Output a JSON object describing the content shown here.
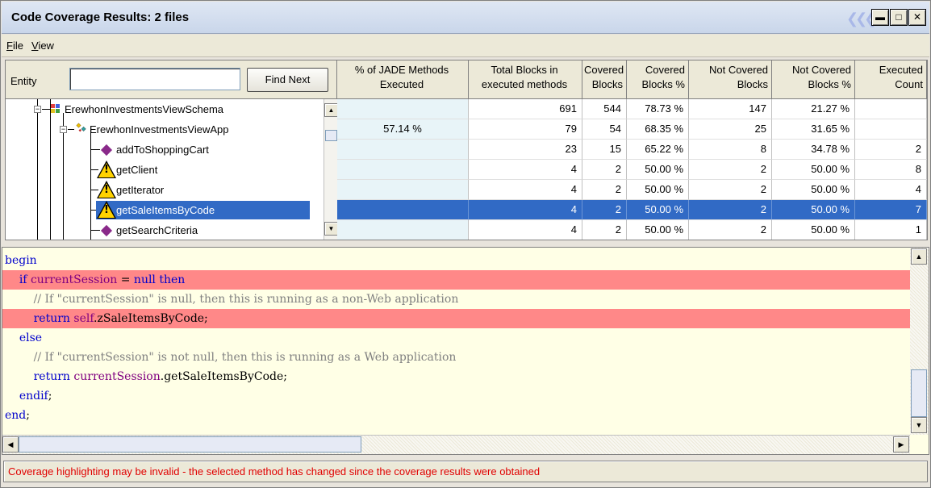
{
  "window": {
    "title": "Code Coverage Results: 2 files",
    "buttons": {
      "minimize": "▬",
      "maximize": "□",
      "close": "✕"
    }
  },
  "menu": [
    {
      "label": "File",
      "mnemonic": "F",
      "rest": "ile"
    },
    {
      "label": "View",
      "mnemonic": "V",
      "rest": "iew"
    }
  ],
  "entity_filter": {
    "label": "Entity",
    "value": "",
    "find_button": "Find Next"
  },
  "tree": [
    {
      "label": "ErewhonInvestmentsViewSchema",
      "icon": "schema-icon",
      "level": 0
    },
    {
      "label": "ErewhonInvestmentsViewApp",
      "icon": "application-icon",
      "level": 1
    },
    {
      "label": "addToShoppingCart",
      "icon": "method-icon",
      "level": 2
    },
    {
      "label": "getClient",
      "icon": "warning-icon",
      "level": 2
    },
    {
      "label": "getIterator",
      "icon": "warning-icon",
      "level": 2
    },
    {
      "label": "getSaleItemsByCode",
      "icon": "warning-icon",
      "level": 2,
      "selected": true
    },
    {
      "label": "getSearchCriteria",
      "icon": "method-icon",
      "level": 2
    }
  ],
  "grid": {
    "columns": [
      {
        "line1": "% of JADE Methods",
        "line2": "Executed"
      },
      {
        "line1": "Total Blocks in",
        "line2": "executed methods"
      },
      {
        "line1": "Covered",
        "line2": "Blocks"
      },
      {
        "line1": "Covered",
        "line2": "Blocks %"
      },
      {
        "line1": "Not Covered",
        "line2": "Blocks"
      },
      {
        "line1": "Not Covered",
        "line2": "Blocks %"
      },
      {
        "line1": "Executed",
        "line2": "Count"
      }
    ],
    "rows": [
      [
        "",
        "691",
        "544",
        "78.73 %",
        "147",
        "21.27 %",
        ""
      ],
      [
        "57.14 %",
        "79",
        "54",
        "68.35 %",
        "25",
        "31.65 %",
        ""
      ],
      [
        "",
        "23",
        "15",
        "65.22 %",
        "8",
        "34.78 %",
        "2"
      ],
      [
        "",
        "4",
        "2",
        "50.00 %",
        "2",
        "50.00 %",
        "8"
      ],
      [
        "",
        "4",
        "2",
        "50.00 %",
        "2",
        "50.00 %",
        "4"
      ],
      [
        "",
        "4",
        "2",
        "50.00 %",
        "2",
        "50.00 %",
        "7"
      ],
      [
        "",
        "4",
        "2",
        "50.00 %",
        "2",
        "50.00 %",
        "1"
      ]
    ],
    "selected_row": 5
  },
  "code": [
    {
      "uncovered": false,
      "tokens": [
        {
          "t": "begin",
          "c": "kw"
        }
      ]
    },
    {
      "uncovered": true,
      "tokens": [
        {
          "t": "    "
        },
        {
          "t": "if",
          "c": "kw"
        },
        {
          "t": " "
        },
        {
          "t": "currentSession",
          "c": "var"
        },
        {
          "t": " = "
        },
        {
          "t": "null",
          "c": "kw"
        },
        {
          "t": " "
        },
        {
          "t": "then",
          "c": "kw"
        }
      ]
    },
    {
      "uncovered": false,
      "tokens": [
        {
          "t": "        "
        },
        {
          "t": "// If \"currentSession\" is null, then this is running as a non-Web application",
          "c": "cm"
        }
      ]
    },
    {
      "uncovered": true,
      "tokens": [
        {
          "t": "        "
        },
        {
          "t": "return",
          "c": "kw"
        },
        {
          "t": " "
        },
        {
          "t": "self",
          "c": "var"
        },
        {
          "t": ".zSaleItemsByCode;"
        }
      ]
    },
    {
      "uncovered": false,
      "tokens": [
        {
          "t": "    "
        },
        {
          "t": "else",
          "c": "kw"
        }
      ]
    },
    {
      "uncovered": false,
      "tokens": [
        {
          "t": "        "
        },
        {
          "t": "// If \"currentSession\" is not null, then this is running as a Web application",
          "c": "cm"
        }
      ]
    },
    {
      "uncovered": false,
      "tokens": [
        {
          "t": "        "
        },
        {
          "t": "return",
          "c": "kw"
        },
        {
          "t": " "
        },
        {
          "t": "currentSession",
          "c": "var"
        },
        {
          "t": ".getSaleItemsByCode;"
        }
      ]
    },
    {
      "uncovered": false,
      "tokens": [
        {
          "t": "    "
        },
        {
          "t": "endif",
          "c": "kw"
        },
        {
          "t": ";"
        }
      ]
    },
    {
      "uncovered": false,
      "tokens": [
        {
          "t": "end",
          "c": "kw"
        },
        {
          "t": ";"
        }
      ]
    }
  ],
  "status": {
    "message": "Coverage highlighting may be invalid - the selected method has changed since the coverage results were obtained",
    "color": "#e00000"
  },
  "colors": {
    "selection": "#316ac5",
    "uncovered_line": "#ff8888",
    "code_background": "#ffffe6",
    "keyword": "#0000cc",
    "identifier": "#800080",
    "comment": "#808080"
  }
}
